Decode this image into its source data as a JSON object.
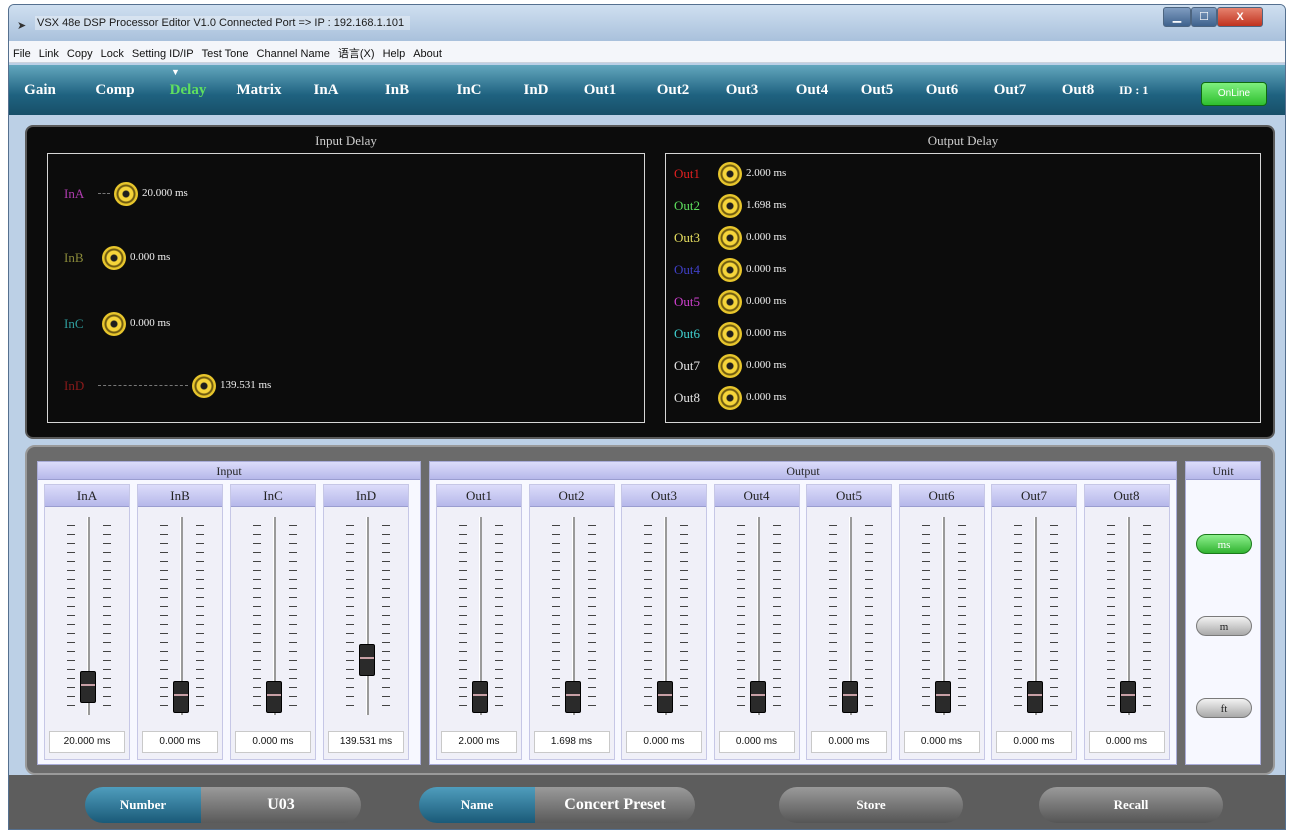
{
  "window": {
    "title": "VSX 48e DSP Processor Editor V1.0    Connected Port => IP : 192.168.1.101",
    "icon": "speaker-icon",
    "controls": {
      "minimize": "▁",
      "maximize": "☐",
      "close": "X"
    }
  },
  "menu": [
    "File",
    "Link",
    "Copy",
    "Lock",
    "Setting ID/IP",
    "Test Tone",
    "Channel Name",
    "语言(X)",
    "Help",
    "About"
  ],
  "tabs": {
    "items": [
      "Gain",
      "Comp",
      "Delay",
      "Matrix",
      "InA",
      "InB",
      "InC",
      "InD",
      "Out1",
      "Out2",
      "Out3",
      "Out4",
      "Out5",
      "Out6",
      "Out7",
      "Out8"
    ],
    "active": "Delay",
    "marker": "▼",
    "device_id": "ID : 1",
    "status": "OnLine",
    "active_color": "#5fe05f",
    "online_color": "#2fbf2f"
  },
  "input_delay": {
    "title": "Input Delay",
    "rows": [
      {
        "label": "InA",
        "value": "20.000 ms",
        "color": "#b03cb0"
      },
      {
        "label": "InB",
        "value": "0.000 ms",
        "color": "#8a8a3a"
      },
      {
        "label": "InC",
        "value": "0.000 ms",
        "color": "#2f9f9f"
      },
      {
        "label": "InD",
        "value": "139.531 ms",
        "color": "#8a1a1a"
      }
    ]
  },
  "output_delay": {
    "title": "Output Delay",
    "rows": [
      {
        "label": "Out1",
        "value": "2.000 ms",
        "color": "#e02020"
      },
      {
        "label": "Out2",
        "value": "1.698 ms",
        "color": "#5ee05e"
      },
      {
        "label": "Out3",
        "value": "0.000 ms",
        "color": "#e8e060"
      },
      {
        "label": "Out4",
        "value": "0.000 ms",
        "color": "#4040c8"
      },
      {
        "label": "Out5",
        "value": "0.000 ms",
        "color": "#d040d0"
      },
      {
        "label": "Out6",
        "value": "0.000 ms",
        "color": "#40d0d0"
      },
      {
        "label": "Out7",
        "value": "0.000 ms",
        "color": "#e6e6e6"
      },
      {
        "label": "Out8",
        "value": "0.000 ms",
        "color": "#e6e6e6"
      }
    ]
  },
  "faders": {
    "input_group": "Input",
    "output_group": "Output",
    "unit_group": "Unit",
    "input": [
      {
        "label": "InA",
        "value": "20.000 ms",
        "level": 0.06
      },
      {
        "label": "InB",
        "value": "0.000 ms",
        "level": 0.0
      },
      {
        "label": "InC",
        "value": "0.000 ms",
        "level": 0.0
      },
      {
        "label": "InD",
        "value": "139.531 ms",
        "level": 0.22
      }
    ],
    "output": [
      {
        "label": "Out1",
        "value": "2.000 ms",
        "level": 0.0
      },
      {
        "label": "Out2",
        "value": "1.698 ms",
        "level": 0.0
      },
      {
        "label": "Out3",
        "value": "0.000 ms",
        "level": 0.0
      },
      {
        "label": "Out4",
        "value": "0.000 ms",
        "level": 0.0
      },
      {
        "label": "Out5",
        "value": "0.000 ms",
        "level": 0.0
      },
      {
        "label": "Out6",
        "value": "0.000 ms",
        "level": 0.0
      },
      {
        "label": "Out7",
        "value": "0.000 ms",
        "level": 0.0
      },
      {
        "label": "Out8",
        "value": "0.000 ms",
        "level": 0.0
      }
    ],
    "units": [
      "ms",
      "m",
      "ft"
    ],
    "selected_unit": "ms"
  },
  "footer": {
    "number_label": "Number",
    "number_value": "U03",
    "name_label": "Name",
    "name_value": "Concert Preset",
    "store_label": "Store",
    "recall_label": "Recall"
  }
}
